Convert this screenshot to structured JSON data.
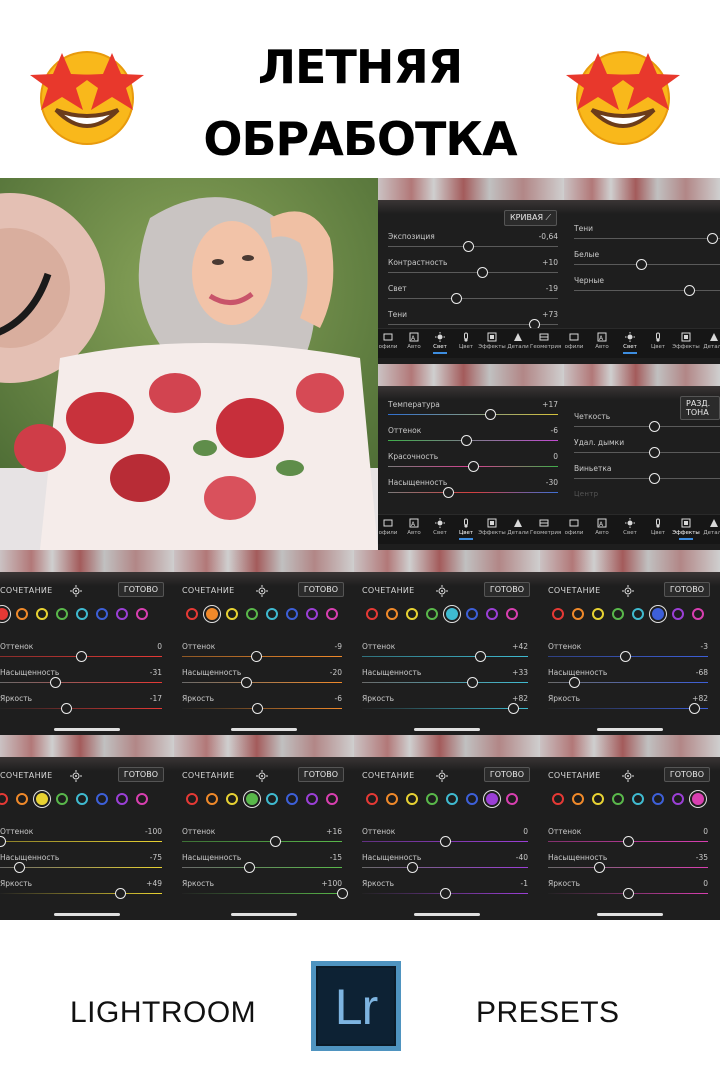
{
  "header": {
    "title_line1": "ЛЕТНЯЯ",
    "title_line2": "ОБРАБОТКА",
    "emoji_icon": "star-struck-emoji"
  },
  "light_panel_a": {
    "curve_button": "КРИВАЯ",
    "sliders": [
      {
        "label": "Экспозиция",
        "value": "-0,64",
        "level": 0.47
      },
      {
        "label": "Контрастность",
        "value": "+10",
        "level": 0.55
      },
      {
        "label": "Свет",
        "value": "-19",
        "level": 0.4
      },
      {
        "label": "Тени",
        "value": "+73",
        "level": 0.86
      }
    ]
  },
  "light_panel_b": {
    "sliders": [
      {
        "label": "Тени",
        "value": "",
        "level": 0.86
      },
      {
        "label": "Белые",
        "value": "",
        "level": 0.42
      },
      {
        "label": "Черные",
        "value": "",
        "level": 0.72
      }
    ]
  },
  "color_panel": {
    "sliders": [
      {
        "label": "Температура",
        "value": "+17",
        "level": 0.6,
        "track": "temp"
      },
      {
        "label": "Оттенок",
        "value": "-6",
        "level": 0.46,
        "track": "tint"
      },
      {
        "label": "Красочность",
        "value": "0",
        "level": 0.5,
        "track": "vib"
      },
      {
        "label": "Насыщенность",
        "value": "-30",
        "level": 0.35,
        "track": "sat"
      }
    ]
  },
  "effects_panel": {
    "split_button": "РАЗД. ТОНА",
    "sliders": [
      {
        "label": "Четкость",
        "value": "",
        "level": 0.5
      },
      {
        "label": "Удал. дымки",
        "value": "",
        "level": 0.5
      },
      {
        "label": "Виньетка",
        "value": "",
        "level": 0.5
      }
    ],
    "faded_label": "Центр"
  },
  "toolbar_a": [
    "офили",
    "Авто",
    "Свет",
    "Цвет",
    "Эффекты",
    "Детали",
    "Геометрия"
  ],
  "toolbar_b": [
    "офили",
    "Авто",
    "Свет",
    "Цвет",
    "Эффекты",
    "Детали"
  ],
  "mix_header": {
    "label": "СОЧЕТАНИЕ",
    "done": "ГОТОВО"
  },
  "mix_slider_labels": [
    "Оттенок",
    "Насыщенность",
    "Яркость"
  ],
  "mix_panels": [
    {
      "selected": 0,
      "values": [
        "0",
        "-31",
        "-17"
      ],
      "levels": [
        0.5,
        0.34,
        0.41
      ]
    },
    {
      "selected": 1,
      "values": [
        "-9",
        "-20",
        "-6"
      ],
      "levels": [
        0.46,
        0.4,
        0.47
      ]
    },
    {
      "selected": 4,
      "values": [
        "+42",
        "+33",
        "+82"
      ],
      "levels": [
        0.71,
        0.66,
        0.91
      ]
    },
    {
      "selected": 5,
      "values": [
        "-3",
        "-68",
        "+82"
      ],
      "levels": [
        0.48,
        0.16,
        0.91
      ]
    },
    {
      "selected": 2,
      "values": [
        "-100",
        "-75",
        "+49"
      ],
      "levels": [
        0.0,
        0.12,
        0.74
      ]
    },
    {
      "selected": 3,
      "values": [
        "+16",
        "-15",
        "+100"
      ],
      "levels": [
        0.58,
        0.42,
        1.0
      ]
    },
    {
      "selected": 6,
      "values": [
        "0",
        "-40",
        "-1"
      ],
      "levels": [
        0.5,
        0.3,
        0.5
      ]
    },
    {
      "selected": 7,
      "values": [
        "0",
        "-35",
        "0"
      ],
      "levels": [
        0.5,
        0.32,
        0.5
      ]
    }
  ],
  "mix_colors": [
    "#e53935",
    "#f0892a",
    "#e8d232",
    "#59b84a",
    "#3fbad0",
    "#3d5fd8",
    "#9b3fd6",
    "#d83fb0"
  ],
  "footer": {
    "left_text": "LIGHTROOM",
    "logo_text": "Lr",
    "right_text": "PRESETS"
  }
}
